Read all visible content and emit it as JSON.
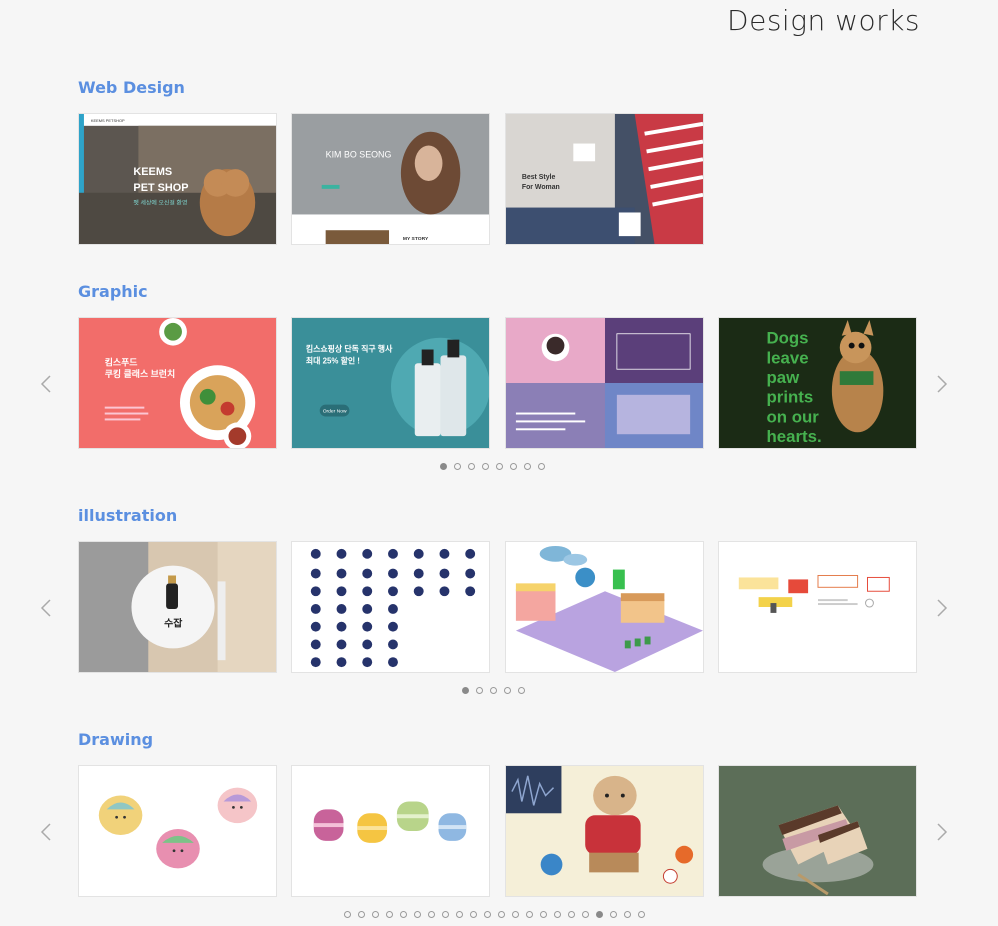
{
  "header": {
    "title": "Design works"
  },
  "sections": [
    {
      "title": "Web Design",
      "dots": 0,
      "active": 0,
      "cards": [
        {
          "texts": [
            "KEEMS PETSHOP",
            "KEEMS",
            "PET SHOP",
            "펫 세상에 오신걸 환영"
          ]
        },
        {
          "texts": [
            "KIM BO SEONG",
            "MY STORY"
          ]
        },
        {
          "texts": [
            "Best Style",
            "For Woman"
          ]
        }
      ]
    },
    {
      "title": "Graphic",
      "dots": 8,
      "active": 0,
      "cards": [
        {
          "texts": [
            "킴스푸드",
            "쿠킹 클래스 브런치"
          ]
        },
        {
          "texts": [
            "킴스쇼핑상 단독 직구 행사",
            "최대 25% 할인 !",
            "Order Now"
          ]
        },
        {
          "texts": []
        },
        {
          "texts": [
            "Dogs",
            "leave",
            "paw",
            "prints",
            "on our",
            "hearts."
          ]
        }
      ]
    },
    {
      "title": "illustration",
      "dots": 5,
      "active": 0,
      "cards": [
        {
          "texts": [
            "수잡"
          ]
        },
        {
          "texts": []
        },
        {
          "texts": []
        },
        {
          "texts": []
        }
      ]
    },
    {
      "title": "Drawing",
      "dots": 22,
      "active": 18,
      "cards": [
        {
          "texts": []
        },
        {
          "texts": []
        },
        {
          "texts": []
        },
        {
          "texts": []
        }
      ]
    }
  ],
  "icons": {
    "prev": "chevron-left-icon",
    "next": "chevron-right-icon"
  },
  "colors": {
    "section_title": "#5b8fe0",
    "background": "#f6f6f6"
  }
}
